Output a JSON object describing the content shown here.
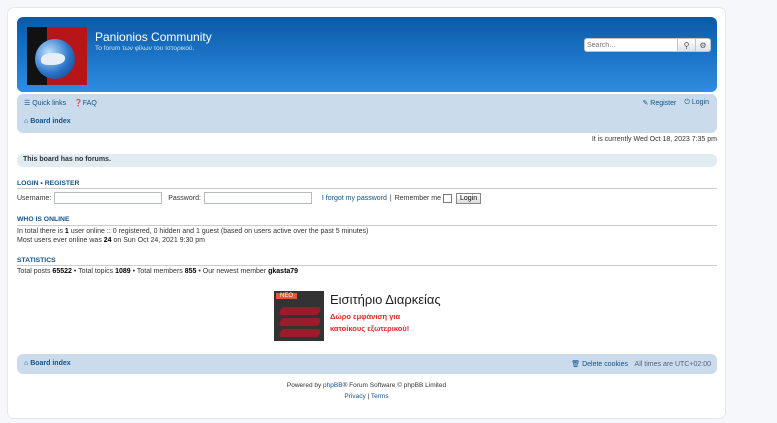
{
  "header": {
    "site_title": "Panionios Community",
    "site_desc": "Το forum των φίλων του Ιστορικού.",
    "search_placeholder": "Search…"
  },
  "nav": {
    "quick_links": "Quick links",
    "faq": "FAQ",
    "register": "Register",
    "login": "Login",
    "breadcrumb": "Board index"
  },
  "time_text": "It is currently Wed Oct 18, 2023 7:35 pm",
  "notice": "This board has no forums.",
  "login_section": {
    "heading_login": "LOGIN",
    "separator": "•",
    "heading_register": "REGISTER",
    "username_label": "Username:",
    "password_label": "Password:",
    "forgot": "I forgot my password",
    "pipe": "|",
    "remember": "Remember me",
    "button": "Login"
  },
  "who_is_online": {
    "heading": "WHO IS ONLINE",
    "line1_a": "In total there is ",
    "line1_b": "1",
    "line1_c": " user online :: 0 registered, 0 hidden and 1 guest (based on users active over the past 5 minutes)",
    "line2_a": "Most users ever online was ",
    "line2_b": "24",
    "line2_c": " on Sun Oct 24, 2021 9:30 pm"
  },
  "statistics": {
    "heading": "STATISTICS",
    "posts_label": "Total posts ",
    "posts": "65522",
    "topics_label": " • Total topics ",
    "topics": "1089",
    "members_label": " • Total members ",
    "members": "855",
    "newest_label": " • Our newest member ",
    "newest": "gkasta79"
  },
  "ad": {
    "badge": "NEO",
    "title": "Εισιτήριο Διαρκείας",
    "sub1": "Δώρο εμφάνιση για",
    "sub2": "κατοίκους εξωτερικού!"
  },
  "footer": {
    "board_index": "Board index",
    "delete_cookies": "Delete cookies",
    "times": "All times are UTC+02:00"
  },
  "powered": {
    "prefix": "Powered by ",
    "phpbb": "phpBB",
    "rest": "® Forum Software © phpBB Limited",
    "privacy": "Privacy",
    "sep": " | ",
    "terms": "Terms"
  }
}
